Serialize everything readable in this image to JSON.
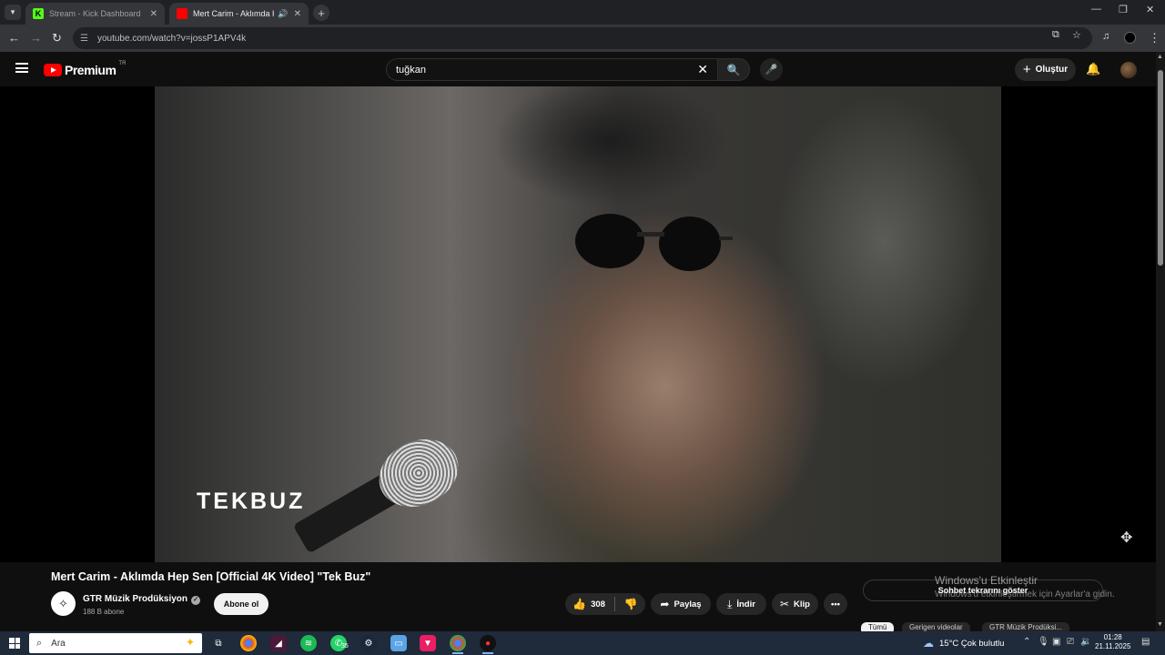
{
  "browser": {
    "tabs": [
      {
        "title": "Stream - Kick Dashboard",
        "favicon_color": "#53fc18",
        "active": false
      },
      {
        "title": "Mert Carim - Aklımda Hep Sen",
        "favicon_color": "#ff0000",
        "active": true
      }
    ],
    "url": "youtube.com/watch?v=jossP1APV4k"
  },
  "youtube": {
    "logo_text": "Premium",
    "country_code": "TR",
    "search_value": "tuğkan",
    "create_label": "Oluştur"
  },
  "video": {
    "overlay_brand": "TEKBUZ",
    "title": "Mert Carim - Aklımda Hep Sen [Official 4K Video] \"Tek Buz\"",
    "channel_name": "GTR Müzik Prodüksiyon",
    "subscribers": "188 B abone",
    "subscribe_label": "Abone ol",
    "likes": "308",
    "share_label": "Paylaş",
    "download_label": "İndir",
    "clip_label": "Klip"
  },
  "sidebar": {
    "chat_label": "Sohbet tekrarını göster",
    "chips": [
      "Tümü",
      "Gerigen videolar",
      "GTR Müzik Prodüksi..."
    ]
  },
  "watermark": {
    "line1": "Windows'u Etkinleştir",
    "line2": "Windows'u etkinleştirmek için Ayarlar'a gidin."
  },
  "taskbar": {
    "search_placeholder": "Ara",
    "whatsapp_badge": "35",
    "weather": "15°C  Çok bulutlu",
    "time": "01:28",
    "date": "21.11.2025"
  },
  "colors": {
    "youtube_red": "#ff0000",
    "page_bg": "#0f0f0f",
    "taskbar_bg": "#1f2a3a"
  }
}
